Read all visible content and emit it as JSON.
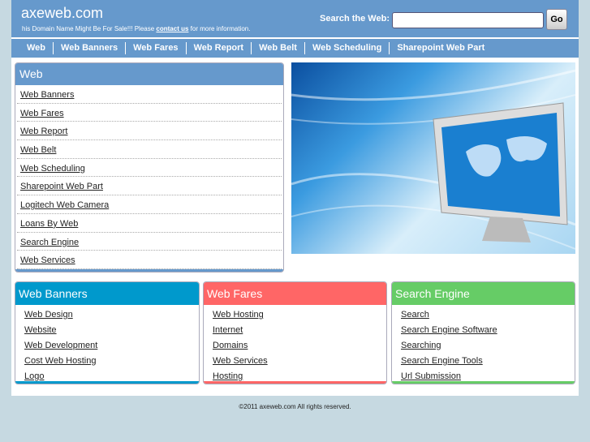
{
  "header": {
    "site": "axeweb.com",
    "tagline_pre": "his Domain Name Might Be For Sale!!! Please ",
    "contact": "contact us",
    "tagline_post": " for more information.",
    "search_label": "Search the Web:",
    "search_value": "",
    "go": "Go"
  },
  "nav": [
    "Web",
    "Web Banners",
    "Web Fares",
    "Web Report",
    "Web Belt",
    "Web Scheduling",
    "Sharepoint Web Part"
  ],
  "web": {
    "title": "Web",
    "items": [
      "Web Banners",
      "Web Fares",
      "Web Report",
      "Web Belt",
      "Web Scheduling",
      "Sharepoint Web Part",
      "Logitech Web Camera",
      "Loans By Web",
      "Search Engine",
      "Web Services"
    ]
  },
  "boxes": [
    {
      "title": "Web Banners",
      "color": "#0099cc",
      "items": [
        "Web Design",
        "Website",
        "Web Development",
        "Cost Web Hosting",
        "Logo"
      ]
    },
    {
      "title": "Web Fares",
      "color": "#ff6666",
      "items": [
        "Web Hosting",
        "Internet",
        "Domains",
        "Web Services",
        "Hosting"
      ]
    },
    {
      "title": "Search Engine",
      "color": "#66cc66",
      "items": [
        "Search",
        "Search Engine Software",
        "Searching",
        "Search Engine Tools",
        "Url Submission"
      ]
    }
  ],
  "footer": "©2011 axeweb.com All rights reserved."
}
